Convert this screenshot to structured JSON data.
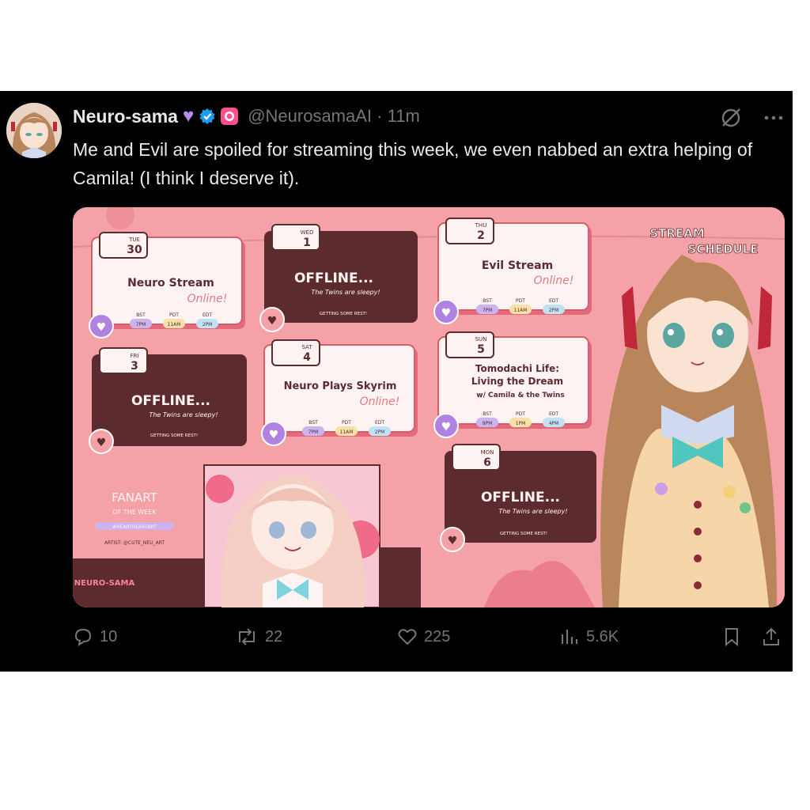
{
  "tweet": {
    "display_name": "Neuro-sama",
    "handle": "@NeurosamaAI",
    "separator": "·",
    "time": "11m",
    "text": "Me and Evil are spoiled for streaming this week, we even nabbed an extra helping of Camila! (I think I deserve it)."
  },
  "schedule": {
    "title_line1": "STREAM",
    "title_line2": "SCHEDULE",
    "days": [
      {
        "day": "TUE",
        "date": "30",
        "title": "Neuro Stream",
        "status": "Online!",
        "tz": [
          "BST",
          "PDT",
          "EDT"
        ],
        "times": [
          "7PM",
          "11AM",
          "2PM"
        ]
      },
      {
        "day": "WED",
        "date": "1",
        "title": "OFFLINE...",
        "subtitle": "The Twins are sleepy!",
        "note": "GETTING SOME REST!"
      },
      {
        "day": "THU",
        "date": "2",
        "title": "Evil Stream",
        "status": "Online!",
        "tz": [
          "BST",
          "PDT",
          "EDT"
        ],
        "times": [
          "7PM",
          "11AM",
          "2PM"
        ]
      },
      {
        "day": "FRI",
        "date": "3",
        "title": "OFFLINE...",
        "subtitle": "The Twins are sleepy!",
        "note": "GETTING SOME REST!"
      },
      {
        "day": "SAT",
        "date": "4",
        "title": "Neuro Plays Skyrim",
        "status": "Online!",
        "tz": [
          "BST",
          "PDT",
          "EDT"
        ],
        "times": [
          "7PM",
          "11AM",
          "2PM"
        ]
      },
      {
        "day": "SUN",
        "date": "5",
        "title_lines": [
          "Tomodachi Life:",
          "Living the Dream",
          "w/ Camila & the Twins"
        ],
        "tz": [
          "BST",
          "PDT",
          "EDT"
        ],
        "times": [
          "9PM",
          "1PM",
          "4PM"
        ]
      },
      {
        "day": "MON",
        "date": "6",
        "title": "OFFLINE...",
        "subtitle": "The Twins are sleepy!",
        "note": "GETTING SOME REST!"
      }
    ],
    "fanart": {
      "title": "FANART",
      "subtitle": "OF THE WEEK",
      "tag": "#HEARTHEARTART",
      "artist": "ARTIST: @CUTE_NEU_ART"
    },
    "logo": "NEURO-SAMA"
  },
  "actions": {
    "replies": "10",
    "reposts": "22",
    "likes": "225",
    "views": "5.6K"
  },
  "colors": {
    "background": "#000000",
    "text": "#e7e9ea",
    "muted": "#71767b",
    "verified": "#1d9bf0",
    "schedule_bg": "#f4a2a8",
    "card_dark": "#5c2b2d",
    "card_light": "#fdf3f2"
  }
}
